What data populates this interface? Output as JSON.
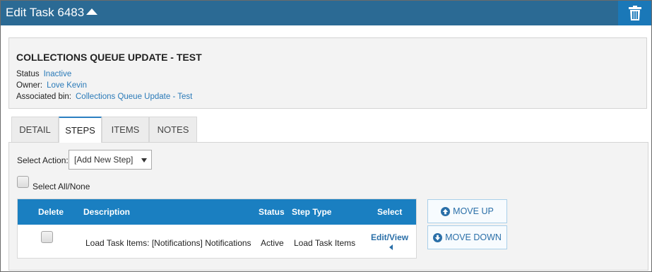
{
  "header": {
    "title": "Edit Task 6483",
    "collapse_icon": "caret-up-icon",
    "delete_icon": "trash-icon",
    "bg_color": "#2b6a94",
    "delete_bg_color": "#1a78b8"
  },
  "task": {
    "name": "COLLECTIONS QUEUE UPDATE - TEST",
    "status_label": "Status",
    "status_value": "Inactive",
    "owner_label": "Owner:",
    "owner_value": "Love Kevin",
    "bin_label": "Associated bin:",
    "bin_value": "Collections Queue Update - Test",
    "link_color": "#2a7ab8"
  },
  "tabs": [
    {
      "label": "DETAIL",
      "active": false
    },
    {
      "label": "STEPS",
      "active": true
    },
    {
      "label": "ITEMS",
      "active": false
    },
    {
      "label": "NOTES",
      "active": false
    }
  ],
  "steps": {
    "select_action_label": "Select Action:",
    "select_action_value": "[Add New Step]",
    "select_all_label": "Select All/None",
    "table": {
      "header_color": "#1a7fc1",
      "columns": [
        "Delete",
        "Description",
        "Status",
        "Step Type",
        "Select"
      ],
      "rows": [
        {
          "description": "Load Task Items: [Notifications] Notifications",
          "status": "Active",
          "step_type": "Load Task Items",
          "select_link": "Edit/View"
        }
      ]
    },
    "move_up_label": "MOVE UP",
    "move_down_label": "MOVE DOWN",
    "move_up_icon": "arrow-circle-up-icon",
    "move_down_icon": "arrow-circle-down-icon"
  }
}
